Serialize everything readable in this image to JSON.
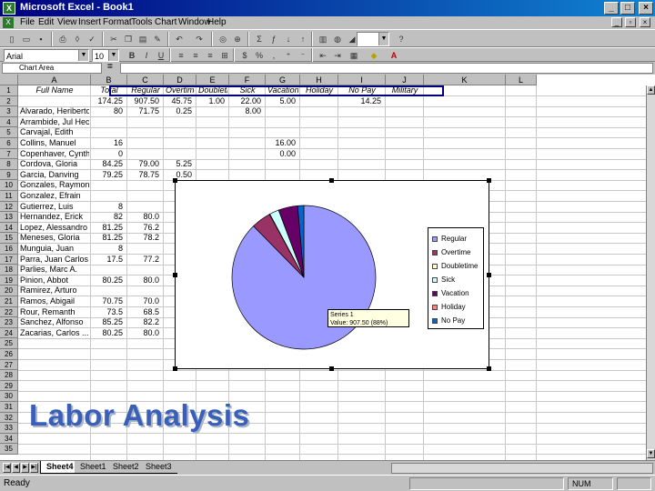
{
  "window": {
    "title": "Microsoft Excel - Book1",
    "app_icon": "excel-icon"
  },
  "menu": [
    "File",
    "Edit",
    "View",
    "Insert",
    "Format",
    "Tools",
    "Chart",
    "Window",
    "Help"
  ],
  "toolbar": {
    "zoom": "",
    "font": "Arial",
    "font_size": "10"
  },
  "formula_bar": {
    "name_box": "Chart Area",
    "equals": "=",
    "value": ""
  },
  "columns": [
    "A",
    "B",
    "C",
    "D",
    "E",
    "F",
    "G",
    "H",
    "I",
    "J",
    "K",
    "L"
  ],
  "rows": [
    "1",
    "2",
    "3",
    "4",
    "5",
    "6",
    "7",
    "8",
    "9",
    "10",
    "11",
    "12",
    "13",
    "14",
    "15",
    "16",
    "17",
    "18",
    "19",
    "20",
    "21",
    "22",
    "23",
    "24",
    "25",
    "26",
    "27",
    "28",
    "29",
    "30",
    "31",
    "32",
    "33",
    "34",
    "35"
  ],
  "headers": [
    "Full Name",
    "Total",
    "Regular",
    "Overtime",
    "Doubletime",
    "Sick",
    "Vacation",
    "Holiday",
    "No Pay",
    "Military"
  ],
  "sheet_rows": [
    {
      "name": "",
      "total": "174.25",
      "regular": "907.50",
      "overtime": "45.75",
      "doubletime": "1.00",
      "sick": "22.00",
      "vacation": "5.00",
      "holiday": "",
      "nopay": "14.25"
    },
    {
      "name": "Alvarado, Heriberto",
      "total": "80",
      "regular": "71.75",
      "overtime": "0.25",
      "doubletime": "",
      "sick": "8.00",
      "vacation": "",
      "holiday": "",
      "nopay": ""
    },
    {
      "name": "Arrambide, Jul Heclo",
      "total": "",
      "regular": "",
      "overtime": "",
      "doubletime": "",
      "sick": "",
      "vacation": "",
      "holiday": "",
      "nopay": ""
    },
    {
      "name": "Carvajal, Edith",
      "total": "",
      "regular": "",
      "overtime": "",
      "doubletime": "",
      "sick": "",
      "vacation": "",
      "holiday": "",
      "nopay": ""
    },
    {
      "name": "Collins, Manuel",
      "total": "16",
      "regular": "",
      "overtime": "",
      "doubletime": "",
      "sick": "",
      "vacation": "16.00",
      "holiday": "",
      "nopay": ""
    },
    {
      "name": "Copenhaver, Cynthia",
      "total": "0",
      "regular": "",
      "overtime": "",
      "doubletime": "",
      "sick": "",
      "vacation": "0.00",
      "holiday": "",
      "nopay": ""
    },
    {
      "name": "Cordova, Gloria",
      "total": "84.25",
      "regular": "79.00",
      "overtime": "5.25",
      "doubletime": "",
      "sick": "",
      "vacation": "",
      "holiday": "",
      "nopay": ""
    },
    {
      "name": "Garcia, Danving",
      "total": "79.25",
      "regular": "78.75",
      "overtime": "0.50",
      "doubletime": "",
      "sick": "",
      "vacation": "",
      "holiday": "",
      "nopay": ""
    },
    {
      "name": "Gonzales, Raymond",
      "total": "",
      "regular": "",
      "overtime": "",
      "doubletime": "",
      "sick": "",
      "vacation": "",
      "holiday": "",
      "nopay": ""
    },
    {
      "name": "Gonzalez, Efrain",
      "total": "",
      "regular": "",
      "overtime": "",
      "doubletime": "",
      "sick": "",
      "vacation": "",
      "holiday": "",
      "nopay": ""
    },
    {
      "name": "Gutierrez, Luis",
      "total": "8",
      "regular": "",
      "overtime": "",
      "doubletime": "",
      "sick": "",
      "vacation": "",
      "holiday": "",
      "nopay": ""
    },
    {
      "name": "Hernandez, Erick",
      "total": "82",
      "regular": "80.0",
      "overtime": "",
      "doubletime": "",
      "sick": "",
      "vacation": "",
      "holiday": "",
      "nopay": ""
    },
    {
      "name": "Lopez, Alessandro",
      "total": "81.25",
      "regular": "76.2",
      "overtime": "",
      "doubletime": "",
      "sick": "",
      "vacation": "",
      "holiday": "",
      "nopay": ""
    },
    {
      "name": "Meneses, Gloria",
      "total": "81.25",
      "regular": "78.2",
      "overtime": "",
      "doubletime": "",
      "sick": "",
      "vacation": "",
      "holiday": "",
      "nopay": ""
    },
    {
      "name": "Munguia, Juan",
      "total": "8",
      "regular": "",
      "overtime": "",
      "doubletime": "",
      "sick": "",
      "vacation": "",
      "holiday": "",
      "nopay": ""
    },
    {
      "name": "Parra, Juan Carlos",
      "total": "17.5",
      "regular": "77.2",
      "overtime": "",
      "doubletime": "",
      "sick": "",
      "vacation": "",
      "holiday": "",
      "nopay": ""
    },
    {
      "name": "Parlies, Marc A.",
      "total": "",
      "regular": "",
      "overtime": "",
      "doubletime": "",
      "sick": "",
      "vacation": "",
      "holiday": "",
      "nopay": ""
    },
    {
      "name": "Pinion, Abbot",
      "total": "80.25",
      "regular": "80.0",
      "overtime": "",
      "doubletime": "",
      "sick": "",
      "vacation": "",
      "holiday": "",
      "nopay": ""
    },
    {
      "name": "Ramirez, Arturo",
      "total": "",
      "regular": "",
      "overtime": "",
      "doubletime": "",
      "sick": "",
      "vacation": "",
      "holiday": "",
      "nopay": ""
    },
    {
      "name": "Ramos, Abigail",
      "total": "70.75",
      "regular": "70.0",
      "overtime": "",
      "doubletime": "",
      "sick": "",
      "vacation": "",
      "holiday": "",
      "nopay": ""
    },
    {
      "name": "Rour, Remanth",
      "total": "73.5",
      "regular": "68.5",
      "overtime": "",
      "doubletime": "",
      "sick": "",
      "vacation": "",
      "holiday": "",
      "nopay": ""
    },
    {
      "name": "Sanchez, Alfonso",
      "total": "85.25",
      "regular": "82.2",
      "overtime": "",
      "doubletime": "",
      "sick": "",
      "vacation": "",
      "holiday": "",
      "nopay": ""
    },
    {
      "name": "Zacarias, Carlos ...",
      "total": "80.25",
      "regular": "80.0",
      "overtime": "",
      "doubletime": "",
      "sick": "",
      "vacation": "",
      "holiday": "",
      "nopay": ""
    }
  ],
  "chart_data": {
    "type": "pie",
    "categories": [
      "Regular",
      "Overtime",
      "Doubletime",
      "Sick",
      "Vacation",
      "Holiday",
      "No Pay"
    ],
    "values": [
      907.5,
      45.75,
      1.0,
      22.0,
      45.0,
      0.0,
      14.25
    ],
    "colors": [
      "#9999ff",
      "#993366",
      "#ffffcc",
      "#ccffff",
      "#660066",
      "#ff8080",
      "#0066cc"
    ],
    "title": "",
    "legend_position": "right",
    "tooltip": {
      "line1": "Series 1",
      "line2": "Value: 907.50 (88%)"
    }
  },
  "tabs": [
    "Sheet4",
    "Sheet1",
    "Sheet2",
    "Sheet3"
  ],
  "status": {
    "text": "Ready",
    "num": "NUM"
  },
  "overlay_title": "Labor Analysis"
}
